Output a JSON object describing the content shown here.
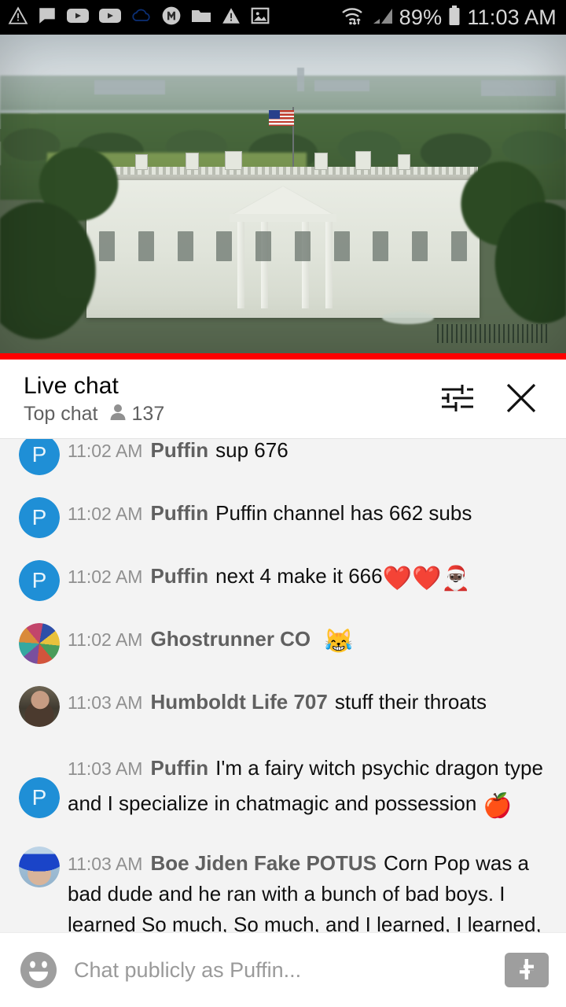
{
  "statusbar": {
    "left_icons": [
      {
        "name": "warning-triangle-icon"
      },
      {
        "name": "chat-bubble-icon"
      },
      {
        "name": "youtube-icon"
      },
      {
        "name": "youtube-icon"
      },
      {
        "name": "cloud-icon"
      },
      {
        "name": "m-circle-icon"
      },
      {
        "name": "folder-icon"
      },
      {
        "name": "warning-triangle-icon"
      },
      {
        "name": "image-icon"
      }
    ],
    "wifi_icon": "wifi-icon",
    "signal_icon": "cell-signal-icon",
    "battery_percent": "89%",
    "battery_icon": "battery-icon",
    "clock": "11:03 AM"
  },
  "player": {
    "live_progress_color": "#ff0000",
    "scene": "white-house-live-webcam"
  },
  "chat_header": {
    "title": "Live chat",
    "mode": "Top chat",
    "viewer_icon": "person-icon",
    "viewer_count": "137",
    "settings_icon": "tune-icon",
    "close_icon": "close-icon"
  },
  "messages": [
    {
      "avatar_type": "letter",
      "avatar_letter": "P",
      "avatar_color": "#1f8fd6",
      "time": "11:02 AM",
      "author": "Puffin",
      "text": "sup 676",
      "emojis": ""
    },
    {
      "avatar_type": "letter",
      "avatar_letter": "P",
      "avatar_color": "#1f8fd6",
      "time": "11:02 AM",
      "author": "Puffin",
      "text": "Puffin channel has 662 subs",
      "emojis": ""
    },
    {
      "avatar_type": "letter",
      "avatar_letter": "P",
      "avatar_color": "#1f8fd6",
      "time": "11:02 AM",
      "author": "Puffin",
      "text": "next 4 make it 666",
      "emojis": "❤️❤️🎅🏿"
    },
    {
      "avatar_type": "collage",
      "avatar_letter": "",
      "avatar_color": "",
      "time": "11:02 AM",
      "author": "Ghostrunner CO",
      "text": "",
      "emojis": "😹"
    },
    {
      "avatar_type": "photo1",
      "avatar_letter": "",
      "avatar_color": "",
      "time": "11:03 AM",
      "author": "Humboldt Life 707",
      "text": "stuff their throats",
      "emojis": ""
    },
    {
      "avatar_type": "letter",
      "avatar_letter": "P",
      "avatar_color": "#1f8fd6",
      "time": "11:03 AM",
      "author": "Puffin",
      "text": "I'm a fairy witch psychic dragon type and I specialize in chatmagic and possession",
      "emojis": "🍎"
    },
    {
      "avatar_type": "photo2",
      "avatar_letter": "",
      "avatar_color": "",
      "time": "11:03 AM",
      "author": "Boe Jiden Fake POTUS",
      "text": "Corn Pop was a bad dude and he ran with a bunch of bad boys. I learned So much, So much, and I learned, I learned, I got hairy legs that turn blonde in the sun.",
      "emojis": ""
    }
  ],
  "input_bar": {
    "emoji_icon": "emoji-smiley-icon",
    "placeholder": "Chat publicly as Puffin...",
    "superchat_icon": "dollar-sign-icon"
  }
}
